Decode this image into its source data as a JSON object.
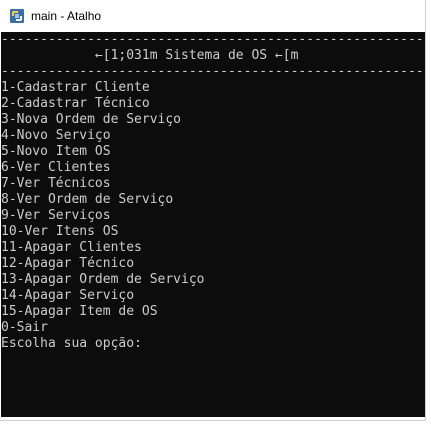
{
  "window": {
    "title": "main - Atalho",
    "icon": "python-icon",
    "controls": [
      "minimize-icon",
      "maximize-icon",
      "close-icon"
    ]
  },
  "console": {
    "background": "#0c0c0c",
    "foreground": "#cccccc",
    "lines": [
      "--------------------------------------------------------",
      "            ←[1;031m Sistema de OS ←[m",
      "--------------------------------------------------------",
      "1-Cadastrar Cliente",
      "2-Cadastrar Técnico",
      "3-Nova Ordem de Serviço",
      "4-Novo Serviço",
      "5-Novo Item OS",
      "6-Ver Clientes",
      "7-Ver Técnicos",
      "8-Ver Ordem de Serviço",
      "9-Ver Serviços",
      "10-Ver Itens OS",
      "11-Apagar Clientes",
      "12-Apagar Técnico",
      "13-Apagar Ordem de Serviço",
      "14-Apagar Serviço",
      "15-Apagar Item de OS",
      "0-Sair",
      "Escolha sua opção:"
    ]
  }
}
